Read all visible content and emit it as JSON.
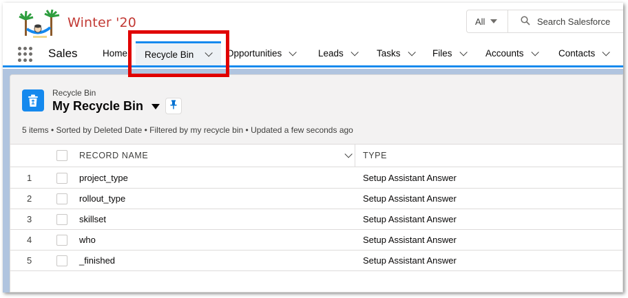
{
  "header": {
    "release_label": "Winter '20",
    "search": {
      "scope": "All",
      "placeholder": "Search Salesforce"
    }
  },
  "nav": {
    "app_name": "Sales",
    "items": [
      {
        "label": "Home",
        "has_menu": false
      },
      {
        "label": "Recycle Bin",
        "has_menu": true,
        "active": true
      },
      {
        "label": "Opportunities",
        "has_menu": true
      },
      {
        "label": "Leads",
        "has_menu": true
      },
      {
        "label": "Tasks",
        "has_menu": true
      },
      {
        "label": "Files",
        "has_menu": true
      },
      {
        "label": "Accounts",
        "has_menu": true
      },
      {
        "label": "Contacts",
        "has_menu": true
      }
    ]
  },
  "list_view": {
    "object_label": "Recycle Bin",
    "title": "My Recycle Bin",
    "meta": "5 items • Sorted by Deleted Date • Filtered by my recycle bin • Updated a few seconds ago",
    "columns": [
      "RECORD NAME",
      "TYPE"
    ],
    "rows": [
      {
        "num": "1",
        "name": "project_type",
        "type": "Setup Assistant Answer"
      },
      {
        "num": "2",
        "name": "rollout_type",
        "type": "Setup Assistant Answer"
      },
      {
        "num": "3",
        "name": "skillset",
        "type": "Setup Assistant Answer"
      },
      {
        "num": "4",
        "name": "who",
        "type": "Setup Assistant Answer"
      },
      {
        "num": "5",
        "name": "_finished",
        "type": "Setup Assistant Answer"
      }
    ]
  },
  "colors": {
    "brand_blue": "#1589ee",
    "highlight_red": "#e00000",
    "release_red": "#c23934"
  }
}
